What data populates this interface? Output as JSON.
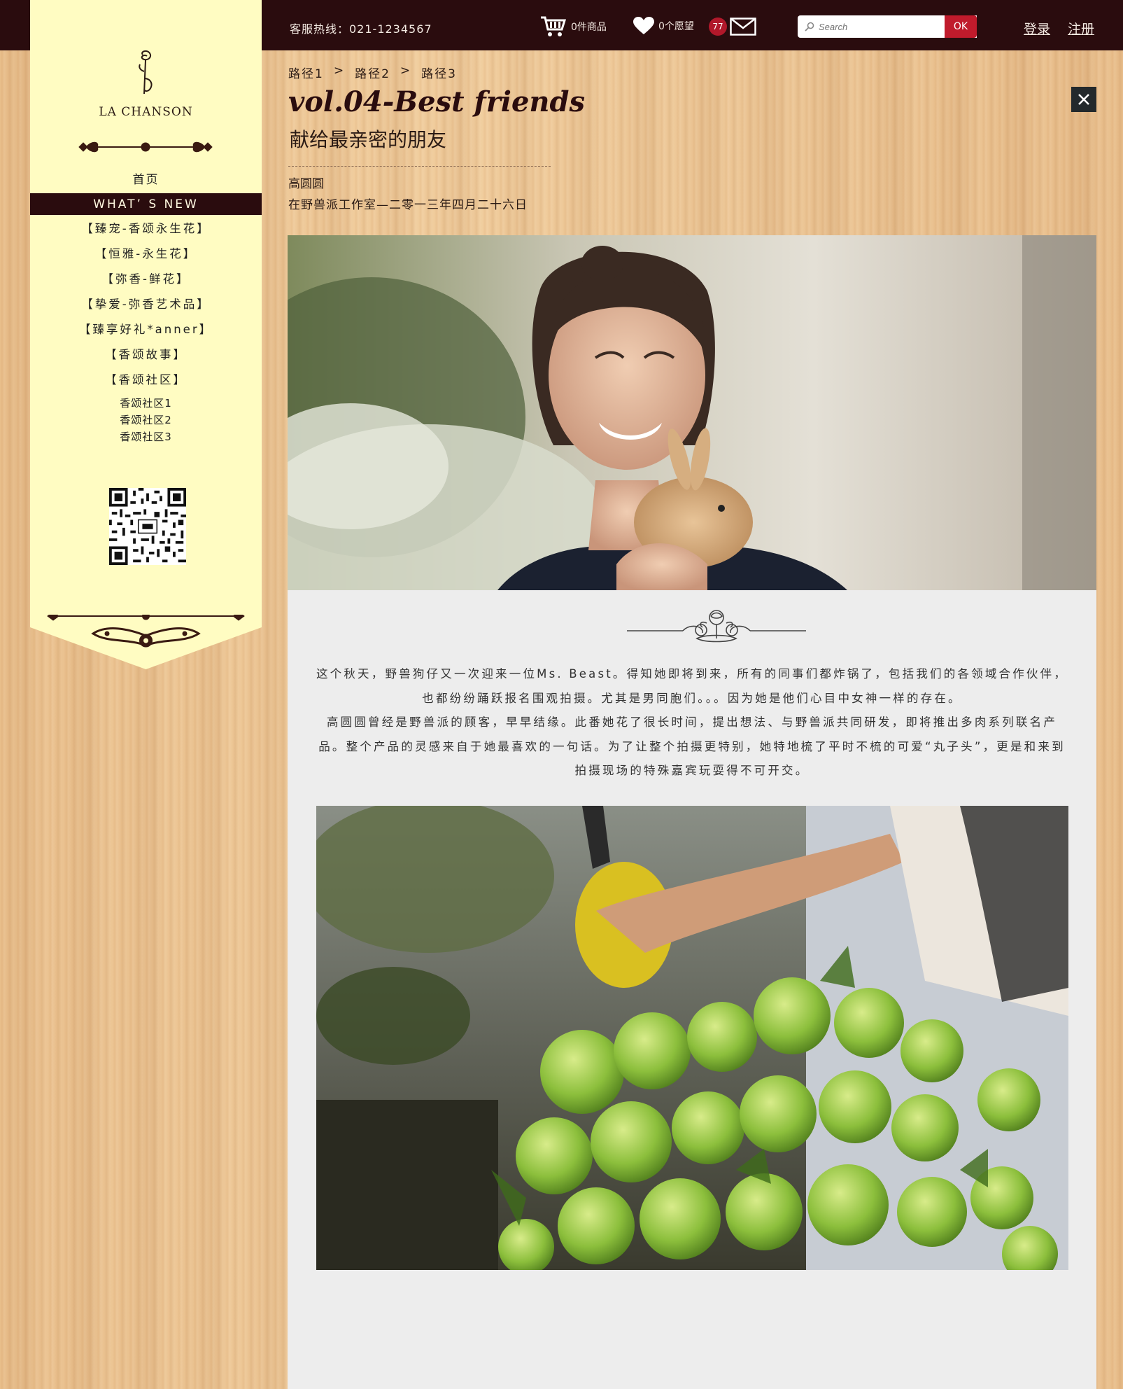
{
  "topbar": {
    "hotline": "客服热线：021-1234567",
    "cart_label": "0件商品",
    "wish_label": "0个愿望",
    "message_count": "77",
    "search_placeholder": "Search",
    "search_button": "OK",
    "login": "登录",
    "register": "注册"
  },
  "sidebar": {
    "brand": "LA CHANSON",
    "home": "首页",
    "whats_new": "WHAT’ S NEW",
    "items": [
      "【臻宠-香颂永生花】",
      "【恒雅-永生花】",
      "【弥香-鲜花】",
      "【挚爱-弥香艺术品】",
      "【臻享好礼*anner】",
      "【香颂故事】",
      "【香颂社区】"
    ],
    "subitems": [
      "香颂社区1",
      "香颂社区2",
      "香颂社区3"
    ]
  },
  "breadcrumb": {
    "items": [
      "路径1",
      "路径2",
      "路径3"
    ],
    "separator": ">"
  },
  "header": {
    "title": "vol.04-Best friends",
    "subtitle": "献给最亲密的朋友",
    "author": "高圆圆",
    "place": "在野兽派工作室—二零一三年四月二十六日"
  },
  "article": {
    "paragraphs": [
      "这个秋天，野兽狗仔又一次迎来一位Ms. Beast。得知她即将到来，所有的同事们都炸锅了，包括我们的各领域合作伙伴，也都纷纷踊跃报名围观拍摄。尤其是男同胞们。。。因为她是他们心目中女神一样的存在。",
      "高圆圆曾经是野兽派的顾客，早早结缘。此番她花了很长时间，提出想法、与野兽派共同研发，即将推出多肉系列联名产品。整个产品的灵感来自于她最喜欢的一句话。为了让整个拍摄更特别，她特地梳了平时不梳的可爱“丸子头”，更是和来到拍摄现场的特殊嘉宾玩耍得不可开交。"
    ]
  },
  "colors": {
    "dark_brown": "#2a0c0e",
    "sidebar_bg": "#fffcc2",
    "accent_red": "#c01b2c",
    "content_bg": "#ededed"
  },
  "icons": [
    "cart-icon",
    "heart-icon",
    "mail-icon",
    "search-icon",
    "close-icon",
    "rose-logo-icon",
    "qr-code",
    "flower-divider-icon"
  ]
}
